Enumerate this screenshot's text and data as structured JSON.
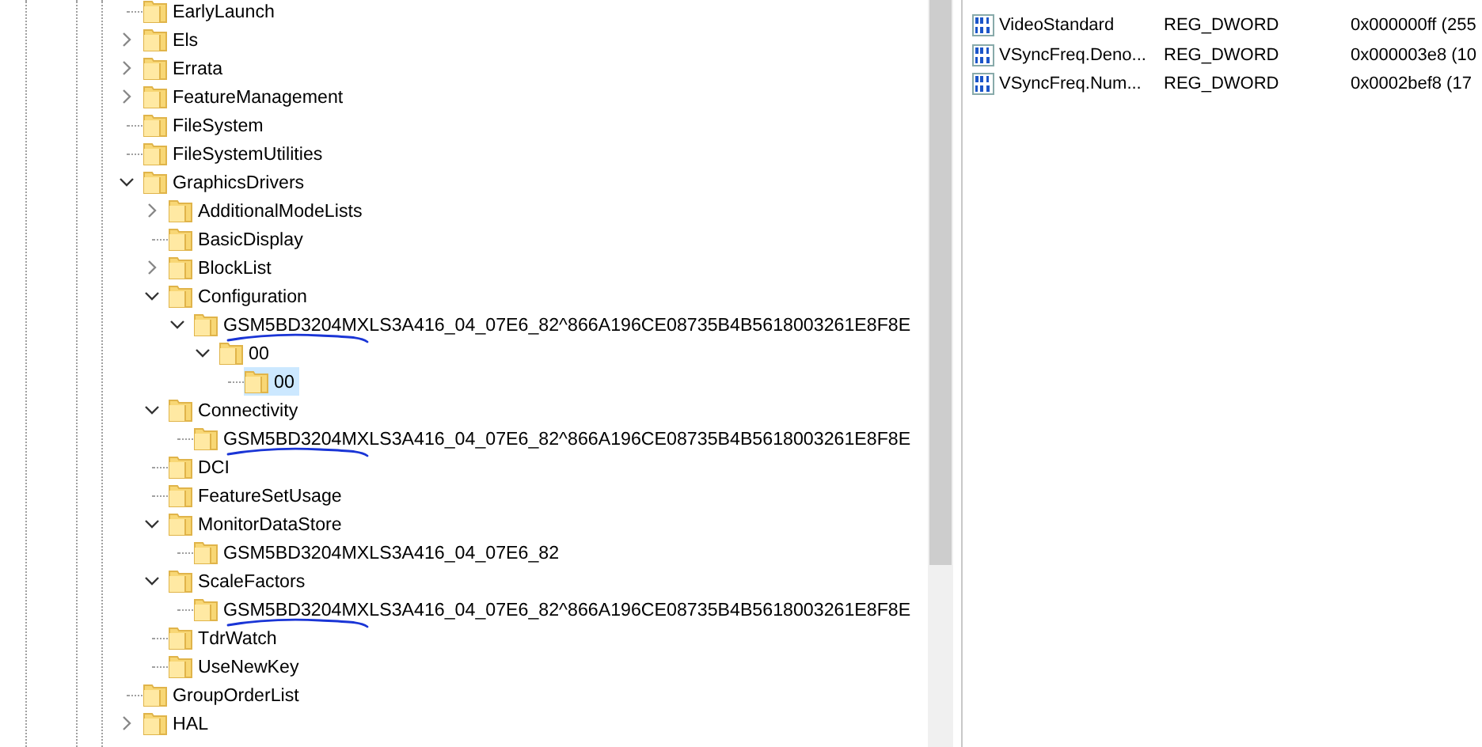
{
  "tree": [
    {
      "label": "EarlyLaunch",
      "kind": "leaf",
      "selected": false,
      "marked": false
    },
    {
      "label": "Els",
      "kind": "collapsed",
      "selected": false,
      "marked": false
    },
    {
      "label": "Errata",
      "kind": "collapsed",
      "selected": false,
      "marked": false
    },
    {
      "label": "FeatureManagement",
      "kind": "collapsed",
      "selected": false,
      "marked": false
    },
    {
      "label": "FileSystem",
      "kind": "leaf",
      "selected": false,
      "marked": false
    },
    {
      "label": "FileSystemUtilities",
      "kind": "leaf",
      "selected": false,
      "marked": false
    },
    {
      "label": "GraphicsDrivers",
      "kind": "expanded",
      "selected": false,
      "marked": false,
      "children": [
        {
          "label": "AdditionalModeLists",
          "kind": "collapsed",
          "selected": false,
          "marked": false
        },
        {
          "label": "BasicDisplay",
          "kind": "leaf",
          "selected": false,
          "marked": false
        },
        {
          "label": "BlockList",
          "kind": "collapsed",
          "selected": false,
          "marked": false
        },
        {
          "label": "Configuration",
          "kind": "expanded",
          "selected": false,
          "marked": false,
          "children": [
            {
              "label": "GSM5BD3204MXLS3A416_04_07E6_82^866A196CE08735B4B5618003261E8F8E",
              "kind": "expanded",
              "selected": false,
              "marked": true,
              "children": [
                {
                  "label": "00",
                  "kind": "expanded",
                  "selected": false,
                  "marked": false,
                  "children": [
                    {
                      "label": "00",
                      "kind": "leaf",
                      "selected": true,
                      "marked": false
                    }
                  ]
                }
              ]
            }
          ]
        },
        {
          "label": "Connectivity",
          "kind": "expanded",
          "selected": false,
          "marked": false,
          "children": [
            {
              "label": "GSM5BD3204MXLS3A416_04_07E6_82^866A196CE08735B4B5618003261E8F8E",
              "kind": "leaf",
              "selected": false,
              "marked": true
            }
          ]
        },
        {
          "label": "DCI",
          "kind": "leaf",
          "selected": false,
          "marked": false
        },
        {
          "label": "FeatureSetUsage",
          "kind": "leaf",
          "selected": false,
          "marked": false
        },
        {
          "label": "MonitorDataStore",
          "kind": "expanded",
          "selected": false,
          "marked": false,
          "children": [
            {
              "label": "GSM5BD3204MXLS3A416_04_07E6_82",
              "kind": "leaf",
              "selected": false,
              "marked": false
            }
          ]
        },
        {
          "label": "ScaleFactors",
          "kind": "expanded",
          "selected": false,
          "marked": false,
          "children": [
            {
              "label": "GSM5BD3204MXLS3A416_04_07E6_82^866A196CE08735B4B5618003261E8F8E",
              "kind": "leaf",
              "selected": false,
              "marked": true
            }
          ]
        },
        {
          "label": "TdrWatch",
          "kind": "leaf",
          "selected": false,
          "marked": false
        },
        {
          "label": "UseNewKey",
          "kind": "leaf",
          "selected": false,
          "marked": false
        }
      ]
    },
    {
      "label": "GroupOrderList",
      "kind": "leaf",
      "selected": false,
      "marked": false
    },
    {
      "label": "HAL",
      "kind": "collapsed",
      "selected": false,
      "marked": false
    }
  ],
  "values": [
    {
      "name": "VideoStandard",
      "type": "REG_DWORD",
      "data": "0x000000ff (255"
    },
    {
      "name": "VSyncFreq.Deno...",
      "type": "REG_DWORD",
      "data": "0x000003e8 (10"
    },
    {
      "name": "VSyncFreq.Num...",
      "type": "REG_DWORD",
      "data": "0x0002bef8 (17"
    }
  ]
}
